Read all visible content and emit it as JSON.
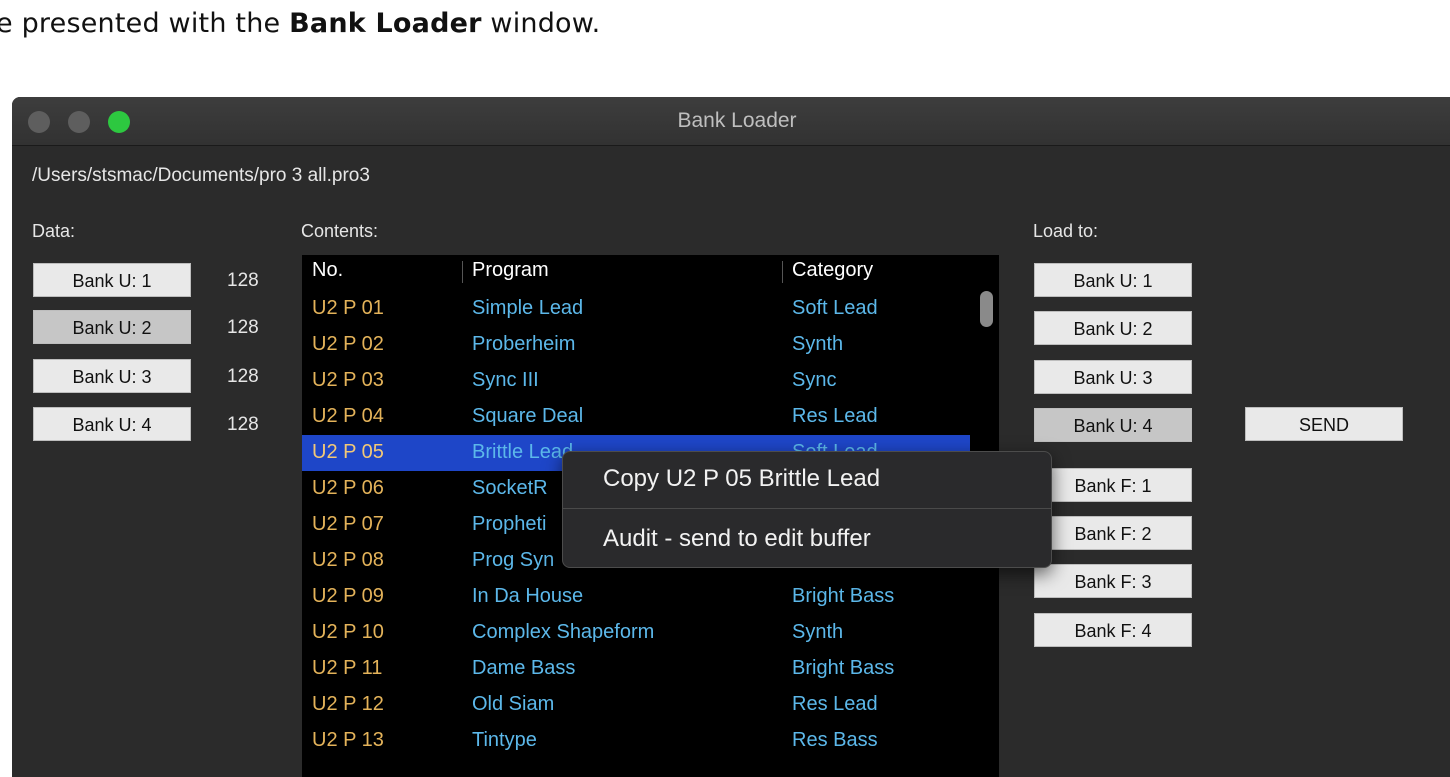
{
  "document": {
    "text_before": "e presented with the ",
    "bold": "Bank Loader",
    "text_after": " window."
  },
  "window": {
    "title": "Bank Loader",
    "file_path": "/Users/stsmac/Documents/pro 3 all.pro3"
  },
  "data_section": {
    "label": "Data:",
    "banks": [
      {
        "label": "Bank U: 1",
        "count": "128",
        "selected": false
      },
      {
        "label": "Bank U: 2",
        "count": "128",
        "selected": true
      },
      {
        "label": "Bank U: 3",
        "count": "128",
        "selected": false
      },
      {
        "label": "Bank U: 4",
        "count": "128",
        "selected": false
      }
    ]
  },
  "contents": {
    "label": "Contents:",
    "columns": [
      "No.",
      "Program",
      "Category"
    ],
    "rows": [
      {
        "no": "U2 P 01",
        "program": "Simple Lead",
        "category": "Soft Lead"
      },
      {
        "no": "U2 P 02",
        "program": "Proberheim",
        "category": "Synth"
      },
      {
        "no": "U2 P 03",
        "program": "Sync III",
        "category": "Sync"
      },
      {
        "no": "U2 P 04",
        "program": "Square Deal",
        "category": "Res Lead"
      },
      {
        "no": "U2 P 05",
        "program": "Brittle Lead",
        "category": "Soft Lead"
      },
      {
        "no": "U2 P 06",
        "program": "SocketR",
        "category": ""
      },
      {
        "no": "U2 P 07",
        "program": "Propheti",
        "category": ""
      },
      {
        "no": "U2 P 08",
        "program": "Prog Syn",
        "category": ""
      },
      {
        "no": "U2 P 09",
        "program": "In Da House",
        "category": "Bright Bass"
      },
      {
        "no": "U2 P 10",
        "program": "Complex Shapeform",
        "category": "Synth"
      },
      {
        "no": "U2 P 11",
        "program": "Dame Bass",
        "category": "Bright Bass"
      },
      {
        "no": "U2 P 12",
        "program": "Old Siam",
        "category": "Res Lead"
      },
      {
        "no": "U2 P 13",
        "program": "Tintype",
        "category": "Res Bass"
      }
    ],
    "selected_row": 4
  },
  "context_menu": {
    "items": [
      "Copy  U2 P 05  Brittle Lead",
      "Audit - send to edit buffer"
    ]
  },
  "load_to": {
    "label": "Load to:",
    "banks": [
      {
        "label": "Bank U: 1",
        "selected": false
      },
      {
        "label": "Bank U: 2",
        "selected": false
      },
      {
        "label": "Bank U: 3",
        "selected": false
      },
      {
        "label": "Bank U: 4",
        "selected": true
      },
      {
        "label": "Bank F: 1",
        "selected": false
      },
      {
        "label": "Bank F: 2",
        "selected": false
      },
      {
        "label": "Bank F: 3",
        "selected": false
      },
      {
        "label": "Bank F: 4",
        "selected": false
      }
    ],
    "send_label": "SEND"
  },
  "colors": {
    "window_bg": "#2b2b2b",
    "number_color": "#e4b35a",
    "program_color": "#5cb8ea",
    "selection": "#1e46c8",
    "traffic_green": "#2dc840"
  }
}
